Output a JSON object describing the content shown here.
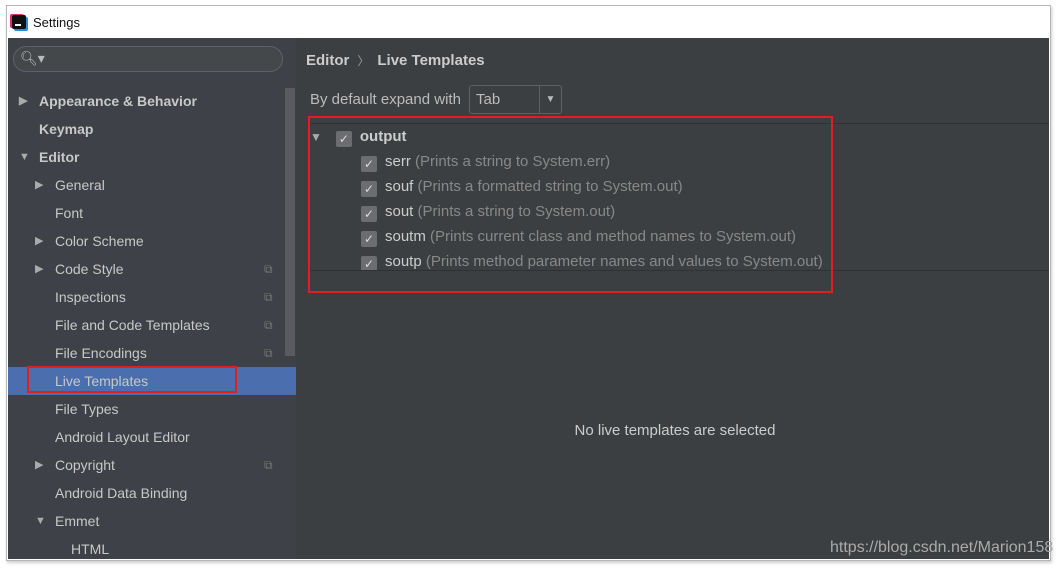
{
  "window": {
    "title": "Settings"
  },
  "sidebar": {
    "search_placeholder": "",
    "items": [
      {
        "label": "Appearance & Behavior",
        "level": 0,
        "arrow": "right",
        "bold": true
      },
      {
        "label": "Keymap",
        "level": 0,
        "arrow": "",
        "bold": true
      },
      {
        "label": "Editor",
        "level": 0,
        "arrow": "down",
        "bold": true
      },
      {
        "label": "General",
        "level": 1,
        "arrow": "right"
      },
      {
        "label": "Font",
        "level": 1,
        "arrow": ""
      },
      {
        "label": "Color Scheme",
        "level": 1,
        "arrow": "right"
      },
      {
        "label": "Code Style",
        "level": 1,
        "arrow": "right",
        "copy": true
      },
      {
        "label": "Inspections",
        "level": 1,
        "arrow": "",
        "copy": true
      },
      {
        "label": "File and Code Templates",
        "level": 1,
        "arrow": "",
        "copy": true
      },
      {
        "label": "File Encodings",
        "level": 1,
        "arrow": "",
        "copy": true
      },
      {
        "label": "Live Templates",
        "level": 1,
        "arrow": "",
        "selected": true
      },
      {
        "label": "File Types",
        "level": 1,
        "arrow": ""
      },
      {
        "label": "Android Layout Editor",
        "level": 1,
        "arrow": ""
      },
      {
        "label": "Copyright",
        "level": 1,
        "arrow": "right",
        "copy": true
      },
      {
        "label": "Android Data Binding",
        "level": 1,
        "arrow": ""
      },
      {
        "label": "Emmet",
        "level": 1,
        "arrow": "down"
      },
      {
        "label": "HTML",
        "level": 2,
        "arrow": ""
      }
    ]
  },
  "main": {
    "breadcrumb": {
      "parent": "Editor",
      "separator": "〉",
      "current": "Live Templates"
    },
    "expand_label": "By default expand with",
    "expand_value": "Tab",
    "group": {
      "name": "output",
      "checked": true
    },
    "templates": [
      {
        "abbr": "serr",
        "desc": "(Prints a string to System.err)",
        "checked": true
      },
      {
        "abbr": "souf",
        "desc": "(Prints a formatted string to System.out)",
        "checked": true
      },
      {
        "abbr": "sout",
        "desc": "(Prints a string to System.out)",
        "checked": true
      },
      {
        "abbr": "soutm",
        "desc": "(Prints current class and method names to System.out)",
        "checked": true
      },
      {
        "abbr": "soutp",
        "desc": "(Prints method parameter names and values to System.out)",
        "checked": true
      }
    ],
    "empty_message": "No live templates are selected"
  },
  "watermark": "https://blog.csdn.net/Marion158",
  "colors": {
    "sidebar_bg": "#3e4148",
    "main_bg": "#3c3f41",
    "selection": "#4b6eaf",
    "highlight_box": "#e02020"
  }
}
